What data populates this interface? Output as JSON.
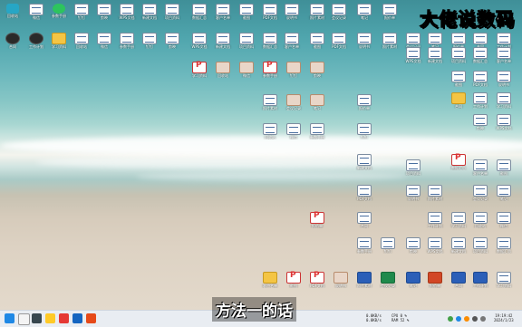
{
  "watermark": "大佬说数码",
  "caption": "方法一的话",
  "desktop": {
    "icon_labels": [
      "回收站",
      "微信",
      "参数手册",
      "钉钉",
      "剪映",
      "WPS文档",
      "新建文档",
      "项目资料",
      "数据汇总",
      "客户名单",
      "截图",
      "PDF文档",
      "说明书",
      "照片素材",
      "会议记录",
      "笔记",
      "报价单",
      "合同",
      "工作计划",
      "学习资料"
    ]
  },
  "taskbar": {
    "net_up": "0.0KB/s",
    "net_down": "0.0KB/s",
    "cpu": "CPU 0 %",
    "ram": "RAM 52 %",
    "time": "19:19:42",
    "date": "2024/1/23"
  }
}
